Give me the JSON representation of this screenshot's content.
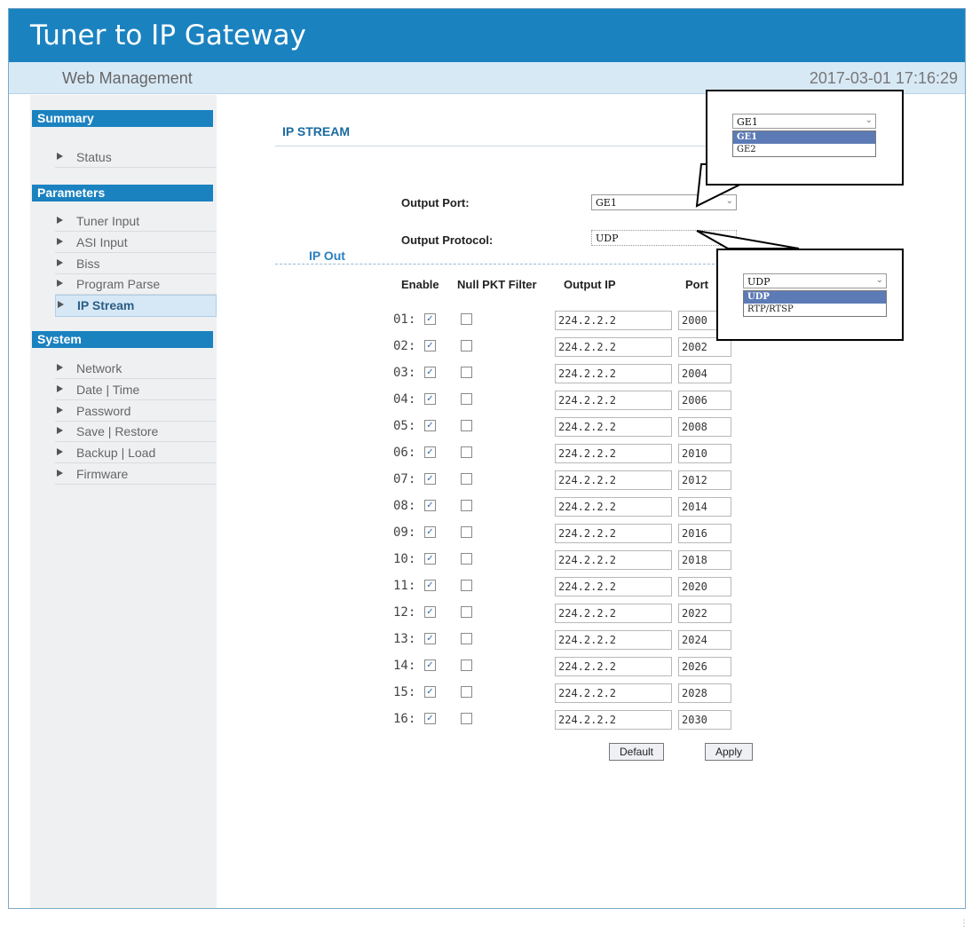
{
  "app": {
    "title": "Tuner to IP Gateway",
    "subtitle": "Web Management",
    "datetime": "2017-03-01 17:16:29"
  },
  "sidebar": {
    "sections": [
      {
        "title": "Summary",
        "items": [
          "Status"
        ]
      },
      {
        "title": "Parameters",
        "items": [
          "Tuner Input",
          "ASI Input",
          "Biss",
          "Program Parse",
          "IP Stream"
        ]
      },
      {
        "title": "System",
        "items": [
          "Network",
          "Date | Time",
          "Password",
          "Save | Restore",
          "Backup | Load",
          "Firmware"
        ]
      }
    ],
    "active_item": "IP Stream"
  },
  "page": {
    "title": "IP STREAM",
    "output_port_label": "Output Port:",
    "output_port_value": "GE1",
    "output_protocol_label": "Output Protocol:",
    "output_protocol_value": "UDP",
    "ip_out_legend": "IP Out"
  },
  "table": {
    "headers": [
      "Enable",
      "Null PKT Filter",
      "Output IP",
      "Port"
    ],
    "rows": [
      {
        "num": "01:",
        "enable": true,
        "null_filter": false,
        "ip": "224.2.2.2",
        "port": "2000"
      },
      {
        "num": "02:",
        "enable": true,
        "null_filter": false,
        "ip": "224.2.2.2",
        "port": "2002"
      },
      {
        "num": "03:",
        "enable": true,
        "null_filter": false,
        "ip": "224.2.2.2",
        "port": "2004"
      },
      {
        "num": "04:",
        "enable": true,
        "null_filter": false,
        "ip": "224.2.2.2",
        "port": "2006"
      },
      {
        "num": "05:",
        "enable": true,
        "null_filter": false,
        "ip": "224.2.2.2",
        "port": "2008"
      },
      {
        "num": "06:",
        "enable": true,
        "null_filter": false,
        "ip": "224.2.2.2",
        "port": "2010"
      },
      {
        "num": "07:",
        "enable": true,
        "null_filter": false,
        "ip": "224.2.2.2",
        "port": "2012"
      },
      {
        "num": "08:",
        "enable": true,
        "null_filter": false,
        "ip": "224.2.2.2",
        "port": "2014"
      },
      {
        "num": "09:",
        "enable": true,
        "null_filter": false,
        "ip": "224.2.2.2",
        "port": "2016"
      },
      {
        "num": "10:",
        "enable": true,
        "null_filter": false,
        "ip": "224.2.2.2",
        "port": "2018"
      },
      {
        "num": "11:",
        "enable": true,
        "null_filter": false,
        "ip": "224.2.2.2",
        "port": "2020"
      },
      {
        "num": "12:",
        "enable": true,
        "null_filter": false,
        "ip": "224.2.2.2",
        "port": "2022"
      },
      {
        "num": "13:",
        "enable": true,
        "null_filter": false,
        "ip": "224.2.2.2",
        "port": "2024"
      },
      {
        "num": "14:",
        "enable": true,
        "null_filter": false,
        "ip": "224.2.2.2",
        "port": "2026"
      },
      {
        "num": "15:",
        "enable": true,
        "null_filter": false,
        "ip": "224.2.2.2",
        "port": "2028"
      },
      {
        "num": "16:",
        "enable": true,
        "null_filter": false,
        "ip": "224.2.2.2",
        "port": "2030"
      }
    ]
  },
  "buttons": {
    "default_label": "Default",
    "apply_label": "Apply"
  },
  "callouts": {
    "port_options": [
      "GE1",
      "GE2"
    ],
    "port_selected": "GE1",
    "protocol_options": [
      "UDP",
      "RTP/RTSP"
    ],
    "protocol_selected": "UDP"
  },
  "colors": {
    "header": "#1b82c0",
    "subheader": "#d8e9f6",
    "sidebar": "#eef0f2",
    "accent": "#1b6aa0"
  },
  "icons": {
    "dropdown": "chevron-down-icon",
    "nav": "triangle-right-icon",
    "check": "checkmark-icon"
  }
}
